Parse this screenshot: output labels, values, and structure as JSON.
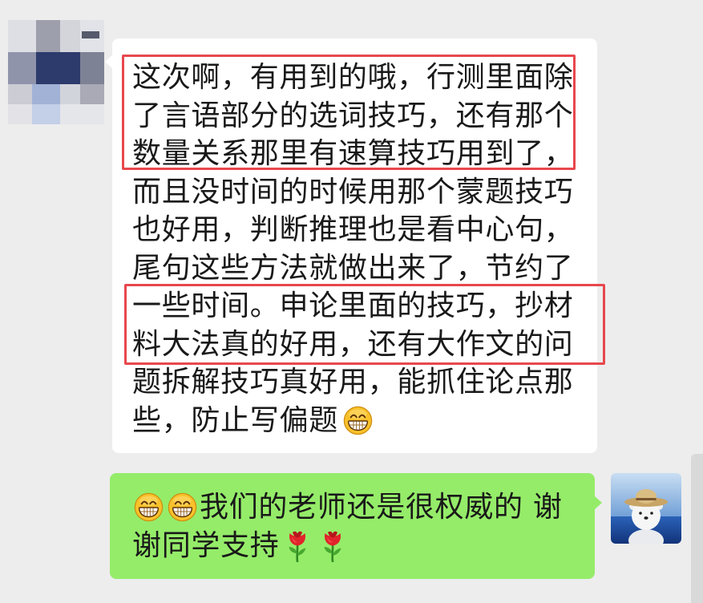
{
  "colors": {
    "page_background": "#ededed",
    "received_bubble": "#ffffff",
    "sent_bubble": "#95ec69",
    "message_text": "#191919",
    "highlight_border": "#e8474d"
  },
  "received_message": {
    "lines": [
      "这次啊，有用到的哦，行测里面除",
      "了言语部分的选词技巧，还有那个",
      "数量关系那里有速算技巧用到了，",
      "而且没时间的时候用那个蒙题技巧",
      "也好用，判断推理也是看中心句，",
      "尾句这些方法就做出来了，节约了",
      "一些时间。申论里面的技巧，抄材",
      "料大法真的好用，还有大作文的问",
      "题拆解技巧真好用，能抓住论点那",
      "些，防止写偏题"
    ],
    "trailing_emoji": "grin-emoji-icon"
  },
  "sent_message": {
    "leading_emojis": [
      "grin-emoji-icon",
      "grin-emoji-icon"
    ],
    "lines": [
      "我们的老师还是很权威的 谢",
      "谢同学支持"
    ],
    "trailing_emojis": [
      "rose-emoji-icon",
      "rose-emoji-icon"
    ]
  }
}
